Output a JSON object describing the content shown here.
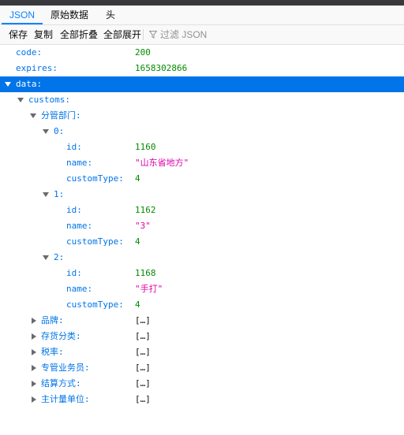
{
  "tabs": [
    "JSON",
    "原始数据",
    "头"
  ],
  "toolbar": {
    "save": "保存",
    "copy": "复制",
    "collapse_all": "全部折叠",
    "expand_all": "全部展开",
    "filter_placeholder": "过滤 JSON"
  },
  "tree": {
    "code": {
      "key": "code:",
      "value": "200"
    },
    "expires": {
      "key": "expires:",
      "value": "1658302866"
    },
    "data_key": "data:",
    "customs_key": "customs:",
    "dept_key": "分管部门:",
    "items": [
      {
        "index": "0:",
        "id_key": "id:",
        "id": "1160",
        "name_key": "name:",
        "name": "\"山东省地方\"",
        "type_key": "customType:",
        "type": "4"
      },
      {
        "index": "1:",
        "id_key": "id:",
        "id": "1162",
        "name_key": "name:",
        "name": "\"3\"",
        "type_key": "customType:",
        "type": "4"
      },
      {
        "index": "2:",
        "id_key": "id:",
        "id": "1168",
        "name_key": "name:",
        "name": "\"手打\"",
        "type_key": "customType:",
        "type": "4"
      }
    ],
    "collapsed": [
      {
        "key": "品牌:",
        "value": "[…]"
      },
      {
        "key": "存货分类:",
        "value": "[…]"
      },
      {
        "key": "税率:",
        "value": "[…]"
      },
      {
        "key": "专管业务员:",
        "value": "[…]"
      },
      {
        "key": "结算方式:",
        "value": "[…]"
      },
      {
        "key": "主计量单位:",
        "value": "[…]"
      }
    ]
  }
}
